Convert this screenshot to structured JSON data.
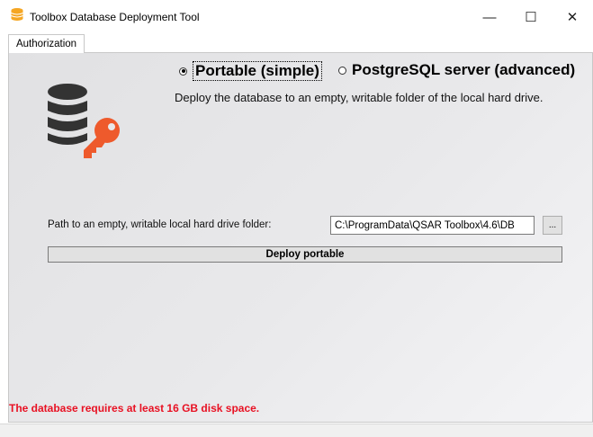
{
  "window": {
    "title": "Toolbox Database Deployment Tool",
    "minimize": "—",
    "maximize": "☐",
    "close": "✕"
  },
  "tabs": [
    {
      "label": "Authorization",
      "selected": true
    }
  ],
  "mode": {
    "portable_label": "Portable (simple)",
    "portable_selected": true,
    "postgres_label": "PostgreSQL server (advanced)",
    "postgres_selected": false,
    "description": "Deploy the database to an empty, writable folder of the local hard drive."
  },
  "path": {
    "label": "Path to an empty, writable local hard drive folder:",
    "value": "C:\\ProgramData\\QSAR Toolbox\\4.6\\DB",
    "browse_label": "..."
  },
  "deploy_button": "Deploy portable",
  "warning": "The database requires at least 16 GB disk space.",
  "colors": {
    "warning": "#e81123",
    "key_icon": "#ee5a2c",
    "database_icon": "#333333",
    "app_icon": "#f5a623"
  },
  "icons": {
    "app": "database-icon",
    "main": "database-key-icon"
  }
}
